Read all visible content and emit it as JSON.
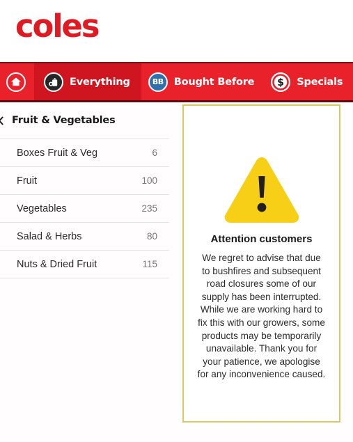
{
  "brand": {
    "logo_text": "coles",
    "logo_color": "#e01a22"
  },
  "nav": {
    "background_color": "#e8212a",
    "active_color": "#cf1620",
    "items": [
      {
        "icon": "home-icon",
        "label": ""
      },
      {
        "icon": "everything-icon",
        "label": "Everything",
        "active": true
      },
      {
        "icon": "bought-before-icon",
        "icon_text": "BB",
        "label": "Bought Before"
      },
      {
        "icon": "specials-dollar-icon",
        "icon_text": "$",
        "label": "Specials"
      }
    ],
    "overflow_label": "•••"
  },
  "sidebar": {
    "header": {
      "title": "Fruit & Vegetables",
      "back_icon": "chevron-left-icon"
    },
    "categories": [
      {
        "name": "Boxes Fruit & Veg",
        "count": "6"
      },
      {
        "name": "Fruit",
        "count": "100"
      },
      {
        "name": "Vegetables",
        "count": "235"
      },
      {
        "name": "Salad & Herbs",
        "count": "80"
      },
      {
        "name": "Nuts & Dried Fruit",
        "count": "115"
      }
    ]
  },
  "notice": {
    "icon": "warning-triangle-icon",
    "border_color": "#d9c95e",
    "icon_color": "#f7cf17",
    "title": "Attention customers",
    "body": "We regret to advise that due to bushfires and subsequent road closures some of our supply has been interrupted. While we are working hard to fix this with our growers, some products may be temporarily unavailable. Thank you for your patience, we apologise for any inconvenience caused."
  }
}
